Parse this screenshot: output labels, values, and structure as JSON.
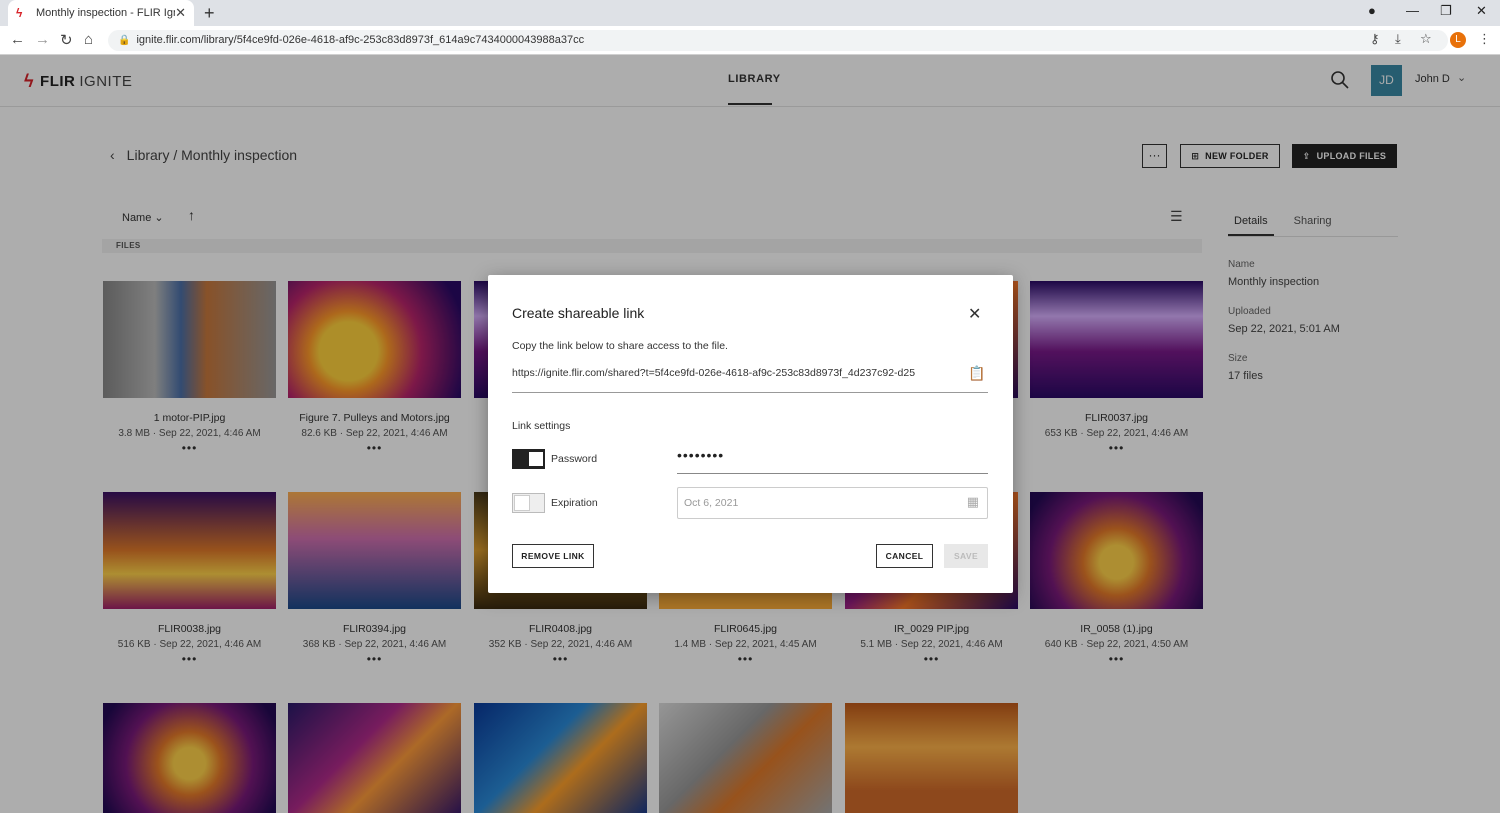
{
  "browser": {
    "tab_title": "Monthly inspection - FLIR Ignite",
    "url": "ignite.flir.com/library/5f4ce9fd-026e-4618-af9c-253c83d8973f_614a9c7434000043988a37cc",
    "profile_initial": "L"
  },
  "app": {
    "logo_brand": "FLIR",
    "logo_product": "IGNITE",
    "nav_library": "LIBRARY",
    "user_initials": "JD",
    "user_name": "John D"
  },
  "toolbar": {
    "breadcrumb": "Library / Monthly inspection",
    "more_label": "···",
    "new_folder_label": "NEW FOLDER",
    "upload_label": "UPLOAD FILES",
    "sort_label": "Name",
    "files_section": "FILES"
  },
  "sidepanel": {
    "tabs": [
      "Details",
      "Sharing"
    ],
    "name_label": "Name",
    "name_value": "Monthly inspection",
    "uploaded_label": "Uploaded",
    "uploaded_value": "Sep 22, 2021, 5:01 AM",
    "size_label": "Size",
    "size_value": "17 files"
  },
  "files": [
    {
      "name": "1 motor-PIP.jpg",
      "meta": "3.8 MB · Sep 22, 2021, 4:46 AM"
    },
    {
      "name": "Figure 7. Pulleys and Motors.jpg",
      "meta": "82.6 KB · Sep 22, 2021, 4:46 AM"
    },
    {
      "name": "FLIR0037.jpg",
      "meta": "653 KB · Sep 22, 2021, 4:46 AM"
    },
    {
      "name": "FLIR0038.jpg",
      "meta": "516 KB · Sep 22, 2021, 4:46 AM"
    },
    {
      "name": "FLIR0394.jpg",
      "meta": "368 KB · Sep 22, 2021, 4:46 AM"
    },
    {
      "name": "FLIR0408.jpg",
      "meta": "352 KB · Sep 22, 2021, 4:46 AM"
    },
    {
      "name": "FLIR0645.jpg",
      "meta": "1.4 MB · Sep 22, 2021, 4:45 AM"
    },
    {
      "name": "IR_0029 PIP.jpg",
      "meta": "5.1 MB · Sep 22, 2021, 4:46 AM"
    },
    {
      "name": "IR_0058 (1).jpg",
      "meta": "640 KB · Sep 22, 2021, 4:50 AM"
    }
  ],
  "modal": {
    "title": "Create shareable link",
    "description": "Copy the link below to share access to the file.",
    "link": "https://ignite.flir.com/shared?t=5f4ce9fd-026e-4618-af9c-253c83d8973f_4d237c92-d25",
    "settings_label": "Link settings",
    "password_label": "Password",
    "password_value": "••••••••",
    "expiration_label": "Expiration",
    "expiration_placeholder": "Oct 6, 2021",
    "remove_label": "REMOVE LINK",
    "cancel_label": "CANCEL",
    "save_label": "SAVE"
  }
}
